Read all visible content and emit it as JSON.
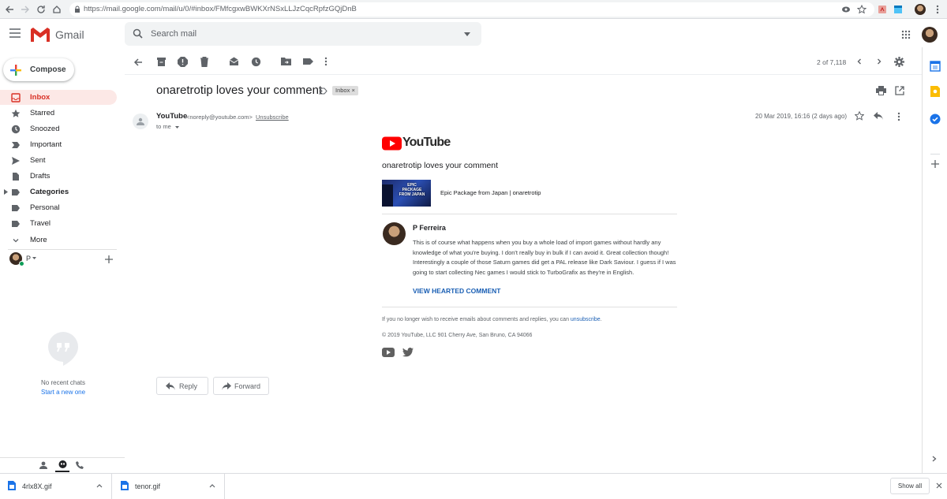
{
  "browser": {
    "url": "https://mail.google.com/mail/u/0/#inbox/FMfcgxwBWKXrNSxLLJzCqcRpfzGQjDnB"
  },
  "gmail": {
    "app_name": "Gmail",
    "search_placeholder": "Search mail",
    "compose_label": "Compose"
  },
  "sidebar": {
    "items": [
      {
        "label": "Inbox",
        "icon": "inbox-icon",
        "active": true
      },
      {
        "label": "Starred",
        "icon": "star-icon"
      },
      {
        "label": "Snoozed",
        "icon": "clock-icon"
      },
      {
        "label": "Important",
        "icon": "important-icon"
      },
      {
        "label": "Sent",
        "icon": "send-icon"
      },
      {
        "label": "Drafts",
        "icon": "draft-icon"
      },
      {
        "label": "Categories",
        "icon": "label-icon"
      },
      {
        "label": "Personal",
        "icon": "label-icon"
      },
      {
        "label": "Travel",
        "icon": "label-icon"
      },
      {
        "label": "More",
        "icon": "chevron-down-icon"
      }
    ],
    "hangouts_user": "P",
    "no_chats": "No recent chats",
    "start_chat": "Start a new one"
  },
  "toolbar": {
    "pager": "2 of 7,118"
  },
  "email": {
    "subject": "onaretrotip loves your comment",
    "label": "Inbox",
    "label_close": "×",
    "sender_name": "YouTube",
    "sender_email": "<noreply@youtube.com>",
    "unsubscribe": "Unsubscribe",
    "to": "to me",
    "date": "20 Mar 2019, 16:16 (2 days ago)"
  },
  "body": {
    "brand": "YouTube",
    "notification": "onaretrotip loves your comment",
    "video_title": "Epic Package from Japan | onaretrotip",
    "thumb_text": "EPIC PACKAGE FROM JAPAN",
    "commenter_name": "P Ferreira",
    "comment": "This is of course what happens when you buy a whole load of import games without hardly any knowledge of what you're buying. I don't really buy in bulk if I can avoid it. Great collection though! Interestingly a couple of those Saturn games did get a PAL release like Dark Saviour. I guess if I was going to start collecting Nec games I would stick to TurboGrafix as they're in English.",
    "view_comment": "VIEW HEARTED COMMENT",
    "footer_text": "If you no longer wish to receive emails about comments and replies, you can ",
    "footer_link": "unsubscribe",
    "footer_end": ".",
    "copyright": "© 2019 YouTube, LLC 901 Cherry Ave, San Bruno, CA 94066"
  },
  "actions": {
    "reply": "Reply",
    "forward": "Forward"
  },
  "downloads": {
    "items": [
      "4rlx8X.gif",
      "tenor.gif"
    ],
    "show_all": "Show all"
  },
  "colors": {
    "gmail_red": "#d93025",
    "youtube_red": "#ff0000",
    "link_blue": "#1a5fb4"
  }
}
